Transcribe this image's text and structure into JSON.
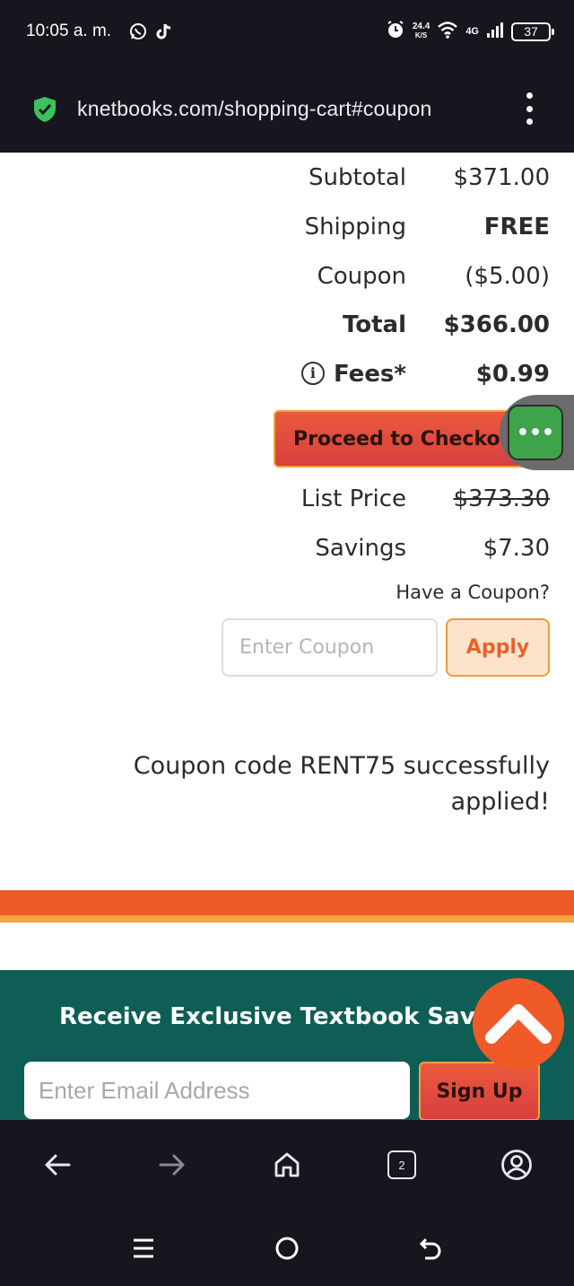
{
  "status_bar": {
    "time": "10:05 a. m.",
    "speed_value": "24.4",
    "speed_unit": "K/S",
    "network": "4G",
    "battery": "37"
  },
  "browser": {
    "url": "knetbooks.com/shopping-cart#coupon",
    "tabs_count": "2"
  },
  "summary": {
    "subtotal_label": "Subtotal",
    "subtotal_value": "$371.00",
    "shipping_label": "Shipping",
    "shipping_value": "FREE",
    "coupon_label": "Coupon",
    "coupon_value": "($5.00)",
    "total_label": "Total",
    "total_value": "$366.00",
    "fees_label": "Fees*",
    "fees_value": "$0.99",
    "checkout_label": "Proceed to Checkout",
    "list_price_label": "List Price",
    "list_price_value": "$373.30",
    "savings_label": "Savings",
    "savings_value": "$7.30"
  },
  "coupon": {
    "question": "Have a Coupon?",
    "placeholder": "Enter Coupon",
    "apply_label": "Apply",
    "success_message": "Coupon code RENT75 successfully applied!"
  },
  "newsletter": {
    "title": "Receive Exclusive Textbook Savings",
    "email_placeholder": "Enter Email Address",
    "signup_label": "Sign Up"
  },
  "colors": {
    "brand_orange": "#f05a28",
    "brand_teal": "#0e5e55",
    "chat_green": "#3ea34b",
    "security_green": "#3cc25c"
  },
  "icons": {
    "secure": "shield-check-icon",
    "chat": "chat-ellipsis-icon",
    "scroll_top": "chevron-up-icon"
  }
}
